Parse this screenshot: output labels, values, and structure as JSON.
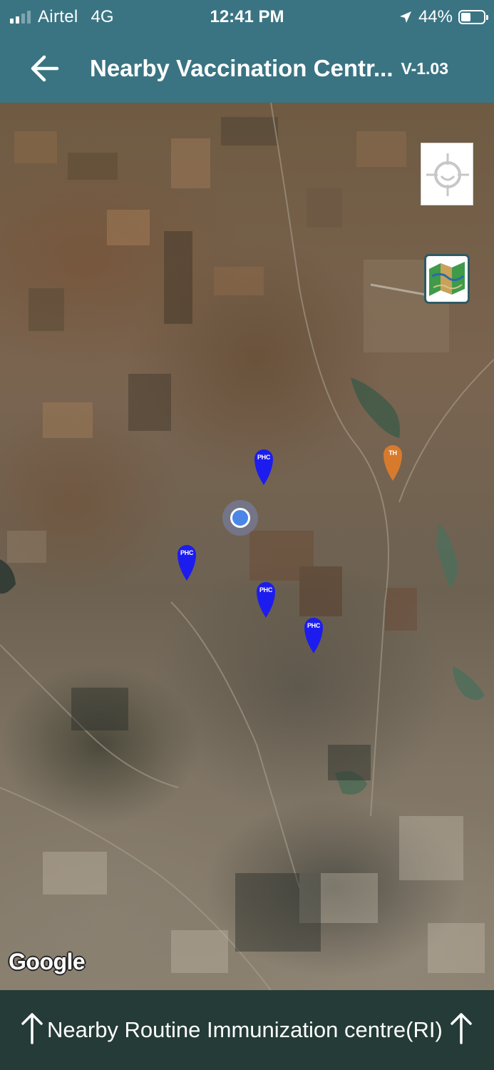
{
  "status_bar": {
    "carrier": "Airtel",
    "network": "4G",
    "time": "12:41 PM",
    "battery_percent": "44%",
    "battery_level": 0.44,
    "signal_bars": 2,
    "icons": [
      "signal-icon",
      "location-arrow-icon",
      "battery-icon"
    ]
  },
  "header": {
    "title": "Nearby Vaccination Centr...",
    "version": "V-1.03",
    "back_icon": "arrow-left-icon"
  },
  "map": {
    "type": "satellite",
    "controls": {
      "locate": "crosshair-icon",
      "layers": "map-layers-icon"
    },
    "markers": [
      {
        "label": "PHC",
        "color": "#1c1cef"
      },
      {
        "label": "TH",
        "color": "#d87a2c"
      },
      {
        "label": "PHC",
        "color": "#1c1cef"
      },
      {
        "label": "PHC",
        "color": "#1c1cef"
      },
      {
        "label": "PHC",
        "color": "#1c1cef"
      }
    ],
    "user_location_color": "#4a86e8",
    "attribution": "Google"
  },
  "bottom_bar": {
    "label": "Nearby Routine Immunization centre(RI)",
    "icon": "arrow-up-icon"
  },
  "colors": {
    "header_bg": "#3a7483",
    "bottom_bar_bg": "#243b37"
  }
}
